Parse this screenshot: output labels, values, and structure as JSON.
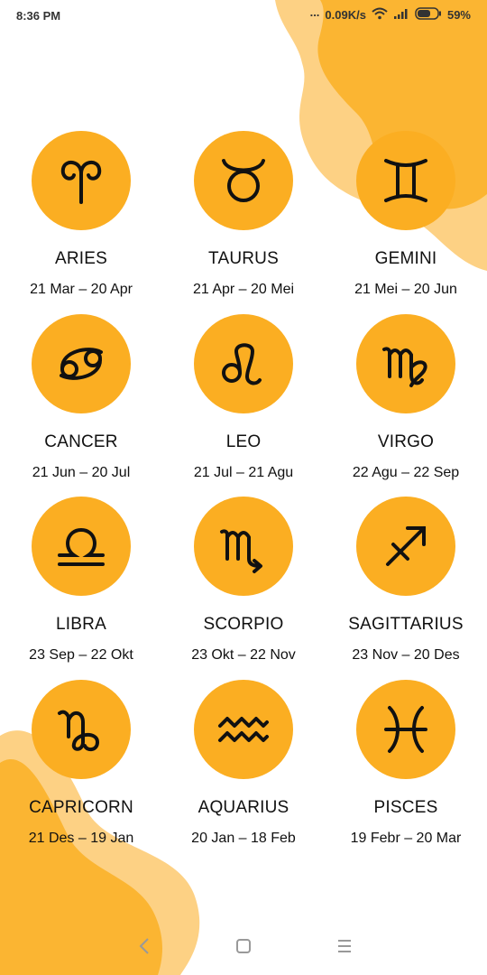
{
  "status_bar": {
    "time": "8:36 PM",
    "dots": "...",
    "net_speed": "0.09K/s",
    "battery": "59%",
    "icons": [
      "wifi-icon",
      "signal-icon",
      "battery-icon"
    ]
  },
  "colors": {
    "accent": "#FBAE22",
    "blob_dark": "#FBB532",
    "blob_light": "#FDD184",
    "background": "#FFFFFF"
  },
  "signs": [
    {
      "name": "ARIES",
      "dates": "21 Mar – 20 Apr",
      "icon": "aries-icon"
    },
    {
      "name": "TAURUS",
      "dates": "21 Apr – 20 Mei",
      "icon": "taurus-icon"
    },
    {
      "name": "GEMINI",
      "dates": "21 Mei – 20 Jun",
      "icon": "gemini-icon"
    },
    {
      "name": "CANCER",
      "dates": "21 Jun – 20 Jul",
      "icon": "cancer-icon"
    },
    {
      "name": "LEO",
      "dates": "21 Jul – 21 Agu",
      "icon": "leo-icon"
    },
    {
      "name": "VIRGO",
      "dates": "22 Agu – 22 Sep",
      "icon": "virgo-icon"
    },
    {
      "name": "LIBRA",
      "dates": "23 Sep – 22 Okt",
      "icon": "libra-icon"
    },
    {
      "name": "SCORPIO",
      "dates": "23 Okt – 22 Nov",
      "icon": "scorpio-icon"
    },
    {
      "name": "SAGITTARIUS",
      "dates": "23 Nov – 20 Des",
      "icon": "sagittarius-icon"
    },
    {
      "name": "CAPRICORN",
      "dates": "21 Des – 19 Jan",
      "icon": "capricorn-icon"
    },
    {
      "name": "AQUARIUS",
      "dates": "20 Jan – 18 Feb",
      "icon": "aquarius-icon"
    },
    {
      "name": "PISCES",
      "dates": "19 Febr – 20 Mar",
      "icon": "pisces-icon"
    }
  ],
  "nav_bar": {
    "icons": [
      "back-icon",
      "home-icon",
      "menu-icon"
    ]
  }
}
